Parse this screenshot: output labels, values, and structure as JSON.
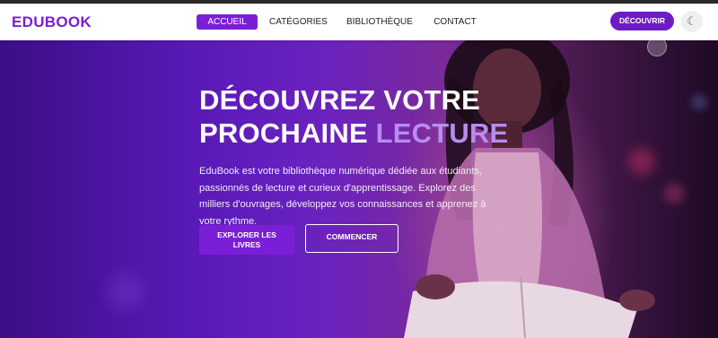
{
  "brand": {
    "logo": "EDUBOOK"
  },
  "nav": {
    "items": [
      {
        "label": "ACCUEIL",
        "active": true
      },
      {
        "label": "CATÉGORIES",
        "active": false
      },
      {
        "label": "BIBLIOTHÈQUE",
        "active": false
      },
      {
        "label": "CONTACT",
        "active": false
      }
    ],
    "cta_label": "DÉCOUVRIR",
    "theme_icon": "moon-icon"
  },
  "hero": {
    "title_line1": "DÉCOUVREZ VOTRE",
    "title_line2_plain": "PROCHAINE ",
    "title_line2_accent": "LECTURE",
    "description": "EduBook est votre bibliothèque numérique dédiée aux étudiants, passionnés de lecture et curieux d'apprentissage. Explorez des milliers d'ouvrages, développez vos connaissances et apprenez à votre rythme.",
    "primary_button": "EXPLORER LES LIVRES",
    "secondary_button": "COMMENCER"
  },
  "colors": {
    "brand_purple": "#7a1fd0",
    "accent_lavender": "#b88cf0",
    "nav_background": "#ffffff"
  }
}
